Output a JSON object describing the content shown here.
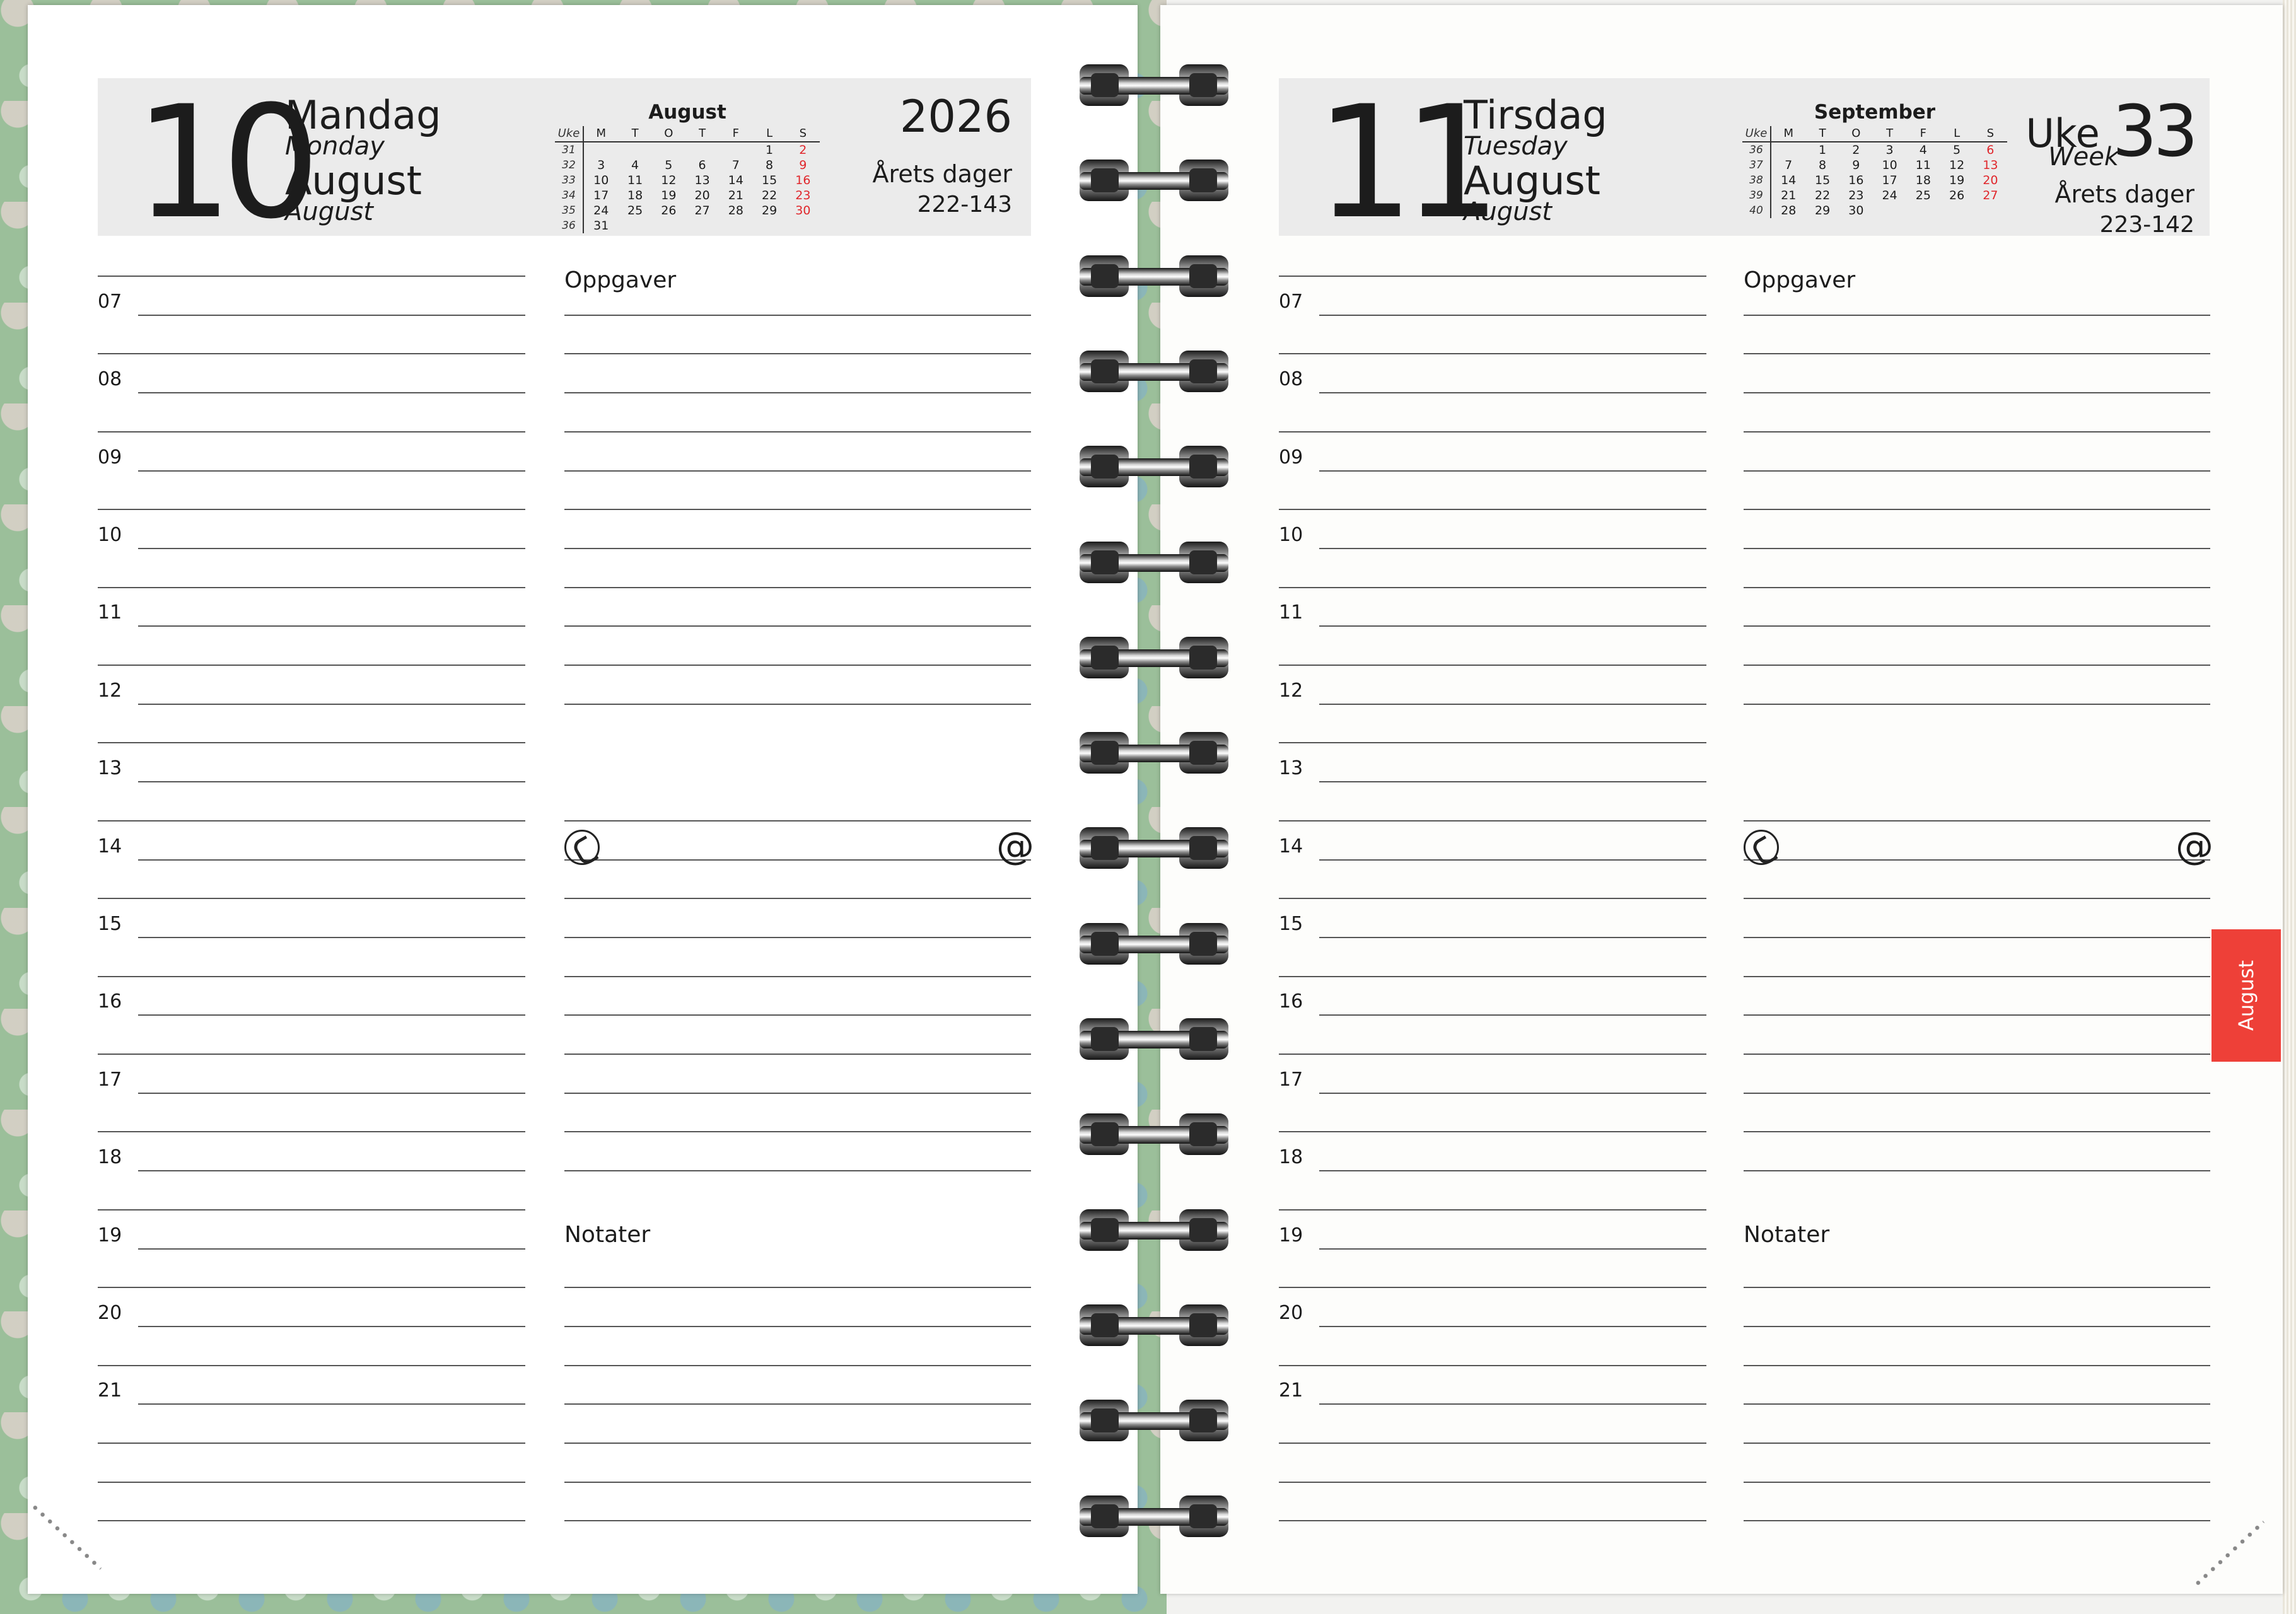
{
  "left": {
    "day_number": "10",
    "weekday_no": "Mandag",
    "weekday_en": "Monday",
    "month_no": "August",
    "month_en": "August",
    "year": "2026",
    "arets_label": "Årets dager",
    "arets_value": "222-143",
    "mini_calendar": {
      "month": "August",
      "headers": [
        "Uke",
        "M",
        "T",
        "O",
        "T",
        "F",
        "L",
        "S"
      ],
      "rows": [
        [
          "31",
          "",
          "",
          "",
          "",
          "",
          "1",
          "2"
        ],
        [
          "32",
          "3",
          "4",
          "5",
          "6",
          "7",
          "8",
          "9"
        ],
        [
          "33",
          "10",
          "11",
          "12",
          "13",
          "14",
          "15",
          "16"
        ],
        [
          "34",
          "17",
          "18",
          "19",
          "20",
          "21",
          "22",
          "23"
        ],
        [
          "35",
          "24",
          "25",
          "26",
          "27",
          "28",
          "29",
          "30"
        ],
        [
          "36",
          "31",
          "",
          "",
          "",
          "",
          "",
          ""
        ]
      ]
    }
  },
  "right": {
    "day_number": "11",
    "weekday_no": "Tirsdag",
    "weekday_en": "Tuesday",
    "month_no": "August",
    "month_en": "August",
    "uke_label": "Uke",
    "week_label": "Week",
    "week_number": "33",
    "arets_label": "Årets dager",
    "arets_value": "223-142",
    "tab_label": "August",
    "mini_calendar": {
      "month": "September",
      "headers": [
        "Uke",
        "M",
        "T",
        "O",
        "T",
        "F",
        "L",
        "S"
      ],
      "rows": [
        [
          "36",
          "",
          "1",
          "2",
          "3",
          "4",
          "5",
          "6"
        ],
        [
          "37",
          "7",
          "8",
          "9",
          "10",
          "11",
          "12",
          "13"
        ],
        [
          "38",
          "14",
          "15",
          "16",
          "17",
          "18",
          "19",
          "20"
        ],
        [
          "39",
          "21",
          "22",
          "23",
          "24",
          "25",
          "26",
          "27"
        ],
        [
          "40",
          "28",
          "29",
          "30",
          "",
          "",
          "",
          ""
        ]
      ]
    }
  },
  "hours": [
    "07",
    "08",
    "09",
    "10",
    "11",
    "12",
    "13",
    "14",
    "15",
    "16",
    "17",
    "18",
    "19",
    "20",
    "21"
  ],
  "tasks_label": "Oppgaver",
  "notes_label": "Notater",
  "icons": {
    "phone": "phone-icon",
    "at": "at-sign-icon"
  }
}
